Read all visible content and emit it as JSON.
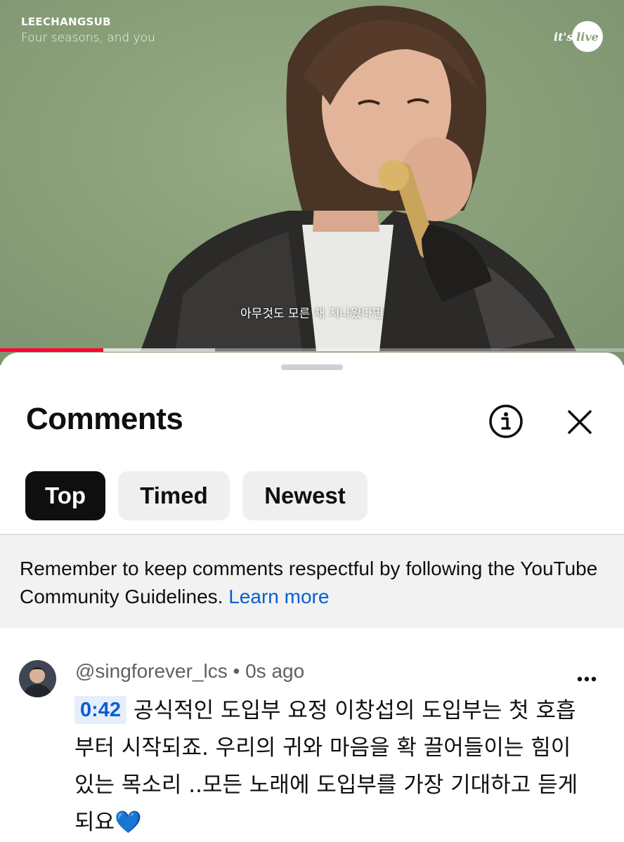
{
  "video": {
    "channel_title": "LEECHANGSUB",
    "song_title": "Four seasons, and you",
    "logo_text": "it's live",
    "caption": "아무것도 모른 채 지나왔다면",
    "progress_played": 0.165,
    "progress_buffered": 0.345
  },
  "comments_panel": {
    "title": "Comments",
    "info_icon": "info-icon",
    "close_icon": "close-icon",
    "sort_chips": [
      {
        "label": "Top",
        "selected": true
      },
      {
        "label": "Timed",
        "selected": false
      },
      {
        "label": "Newest",
        "selected": false
      }
    ],
    "notice": {
      "text": "Remember to keep comments respectful by following the YouTube Community Guidelines.",
      "link": "Learn more"
    }
  },
  "comment": {
    "author": "@singforever_lcs",
    "separator": "•",
    "time": "0s ago",
    "timestamp": "0:42",
    "text": "공식적인 도입부 요정 이창섭의 도입부는 첫 호흡부터 시작되죠. 우리의 귀와 마음을 확 끌어들이는 힘이 있는 목소리 ..모든 노래에 도입부를 가장 기대하고 듣게되요",
    "emoji": "💙",
    "menu_icon": "more-vert-icon"
  },
  "colors": {
    "video_bg": "#8aa079",
    "progress_red": "#ff0033",
    "link_blue": "#065fd4",
    "chip_active": "#0f0f0f",
    "chip_inactive": "#efefef"
  }
}
